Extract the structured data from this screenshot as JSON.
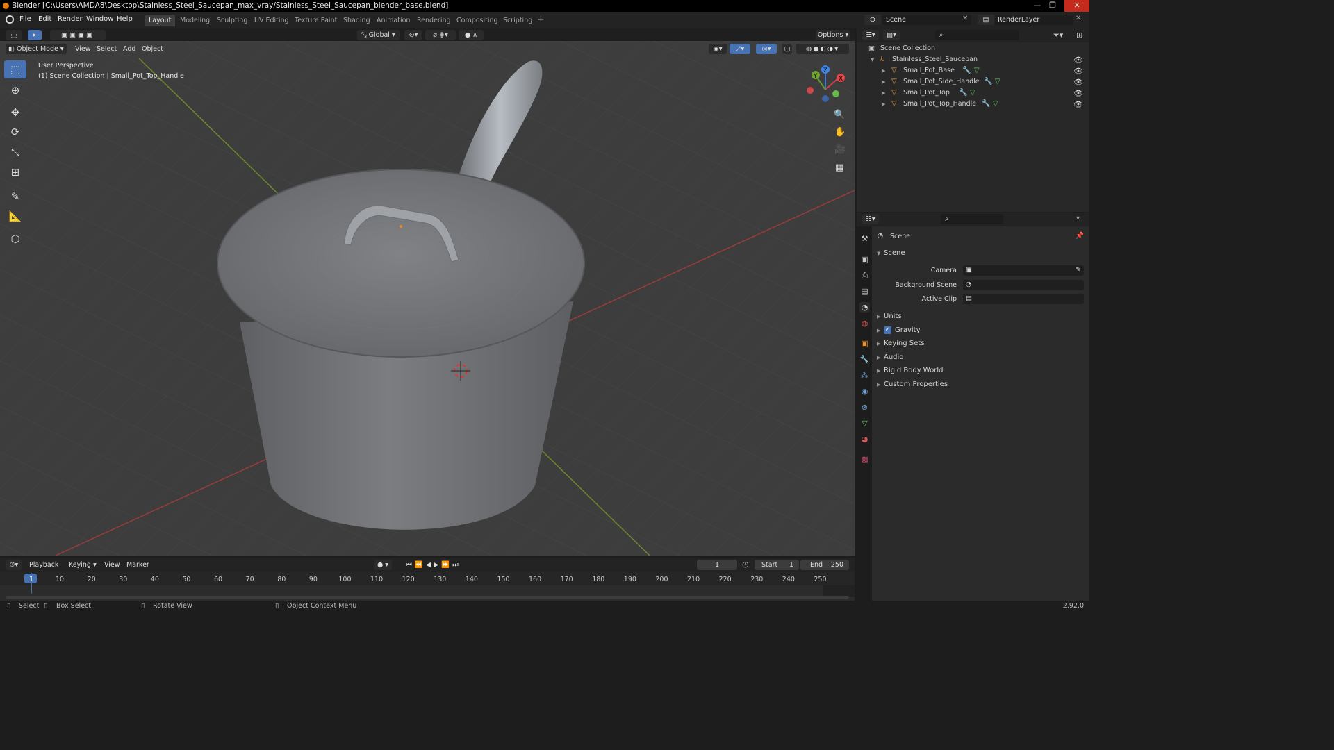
{
  "window": {
    "title": "Blender [C:\\Users\\AMDA8\\Desktop\\Stainless_Steel_Saucepan_max_vray/Stainless_Steel_Saucepan_blender_base.blend]",
    "minimize": "—",
    "maximize": "❐",
    "close": "✕"
  },
  "menu": [
    "File",
    "Edit",
    "Render",
    "Window",
    "Help"
  ],
  "workspaces": [
    "Layout",
    "Modeling",
    "Sculpting",
    "UV Editing",
    "Texture Paint",
    "Shading",
    "Animation",
    "Rendering",
    "Compositing",
    "Scripting"
  ],
  "add_workspace": "+",
  "scene_selector": {
    "value": "Scene"
  },
  "view_layer": {
    "value": "RenderLayer"
  },
  "viewport_header": {
    "orientation": "Global",
    "options": "Options",
    "mode": "Object Mode",
    "menus": [
      "View",
      "Select",
      "Add",
      "Object"
    ]
  },
  "viewport": {
    "perspective": "User Perspective",
    "collection_info": "(1) Scene Collection | Small_Pot_Top_Handle",
    "gizmo": {
      "x": "X",
      "y": "Y",
      "z": "Z"
    }
  },
  "outliner": {
    "root": "Scene Collection",
    "collection": "Stainless_Steel_Saucepan",
    "objects": [
      "Small_Pot_Base",
      "Small_Pot_Side_Handle",
      "Small_Pot_Top",
      "Small_Pot_Top_Handle"
    ]
  },
  "properties": {
    "header_title": "Scene",
    "panel_title": "Scene",
    "fields": [
      {
        "label": "Camera",
        "value": ""
      },
      {
        "label": "Background Scene",
        "value": ""
      },
      {
        "label": "Active Clip",
        "value": ""
      }
    ],
    "sections": [
      "Units",
      "Gravity",
      "Keying Sets",
      "Audio",
      "Rigid Body World",
      "Custom Properties"
    ],
    "gravity_checked": true
  },
  "timeline": {
    "menus": [
      "Playback",
      "Keying",
      "View",
      "Marker"
    ],
    "current_frame": "1",
    "start_label": "Start",
    "start": "1",
    "end_label": "End",
    "end": "250",
    "ticks": [
      "1",
      "10",
      "20",
      "30",
      "40",
      "50",
      "60",
      "70",
      "80",
      "90",
      "100",
      "110",
      "120",
      "130",
      "140",
      "150",
      "160",
      "170",
      "180",
      "190",
      "200",
      "210",
      "220",
      "230",
      "240",
      "250"
    ]
  },
  "statusbar": {
    "items": [
      "Select",
      "Box Select",
      "Rotate View",
      "Object Context Menu"
    ],
    "version": "2.92.0"
  }
}
